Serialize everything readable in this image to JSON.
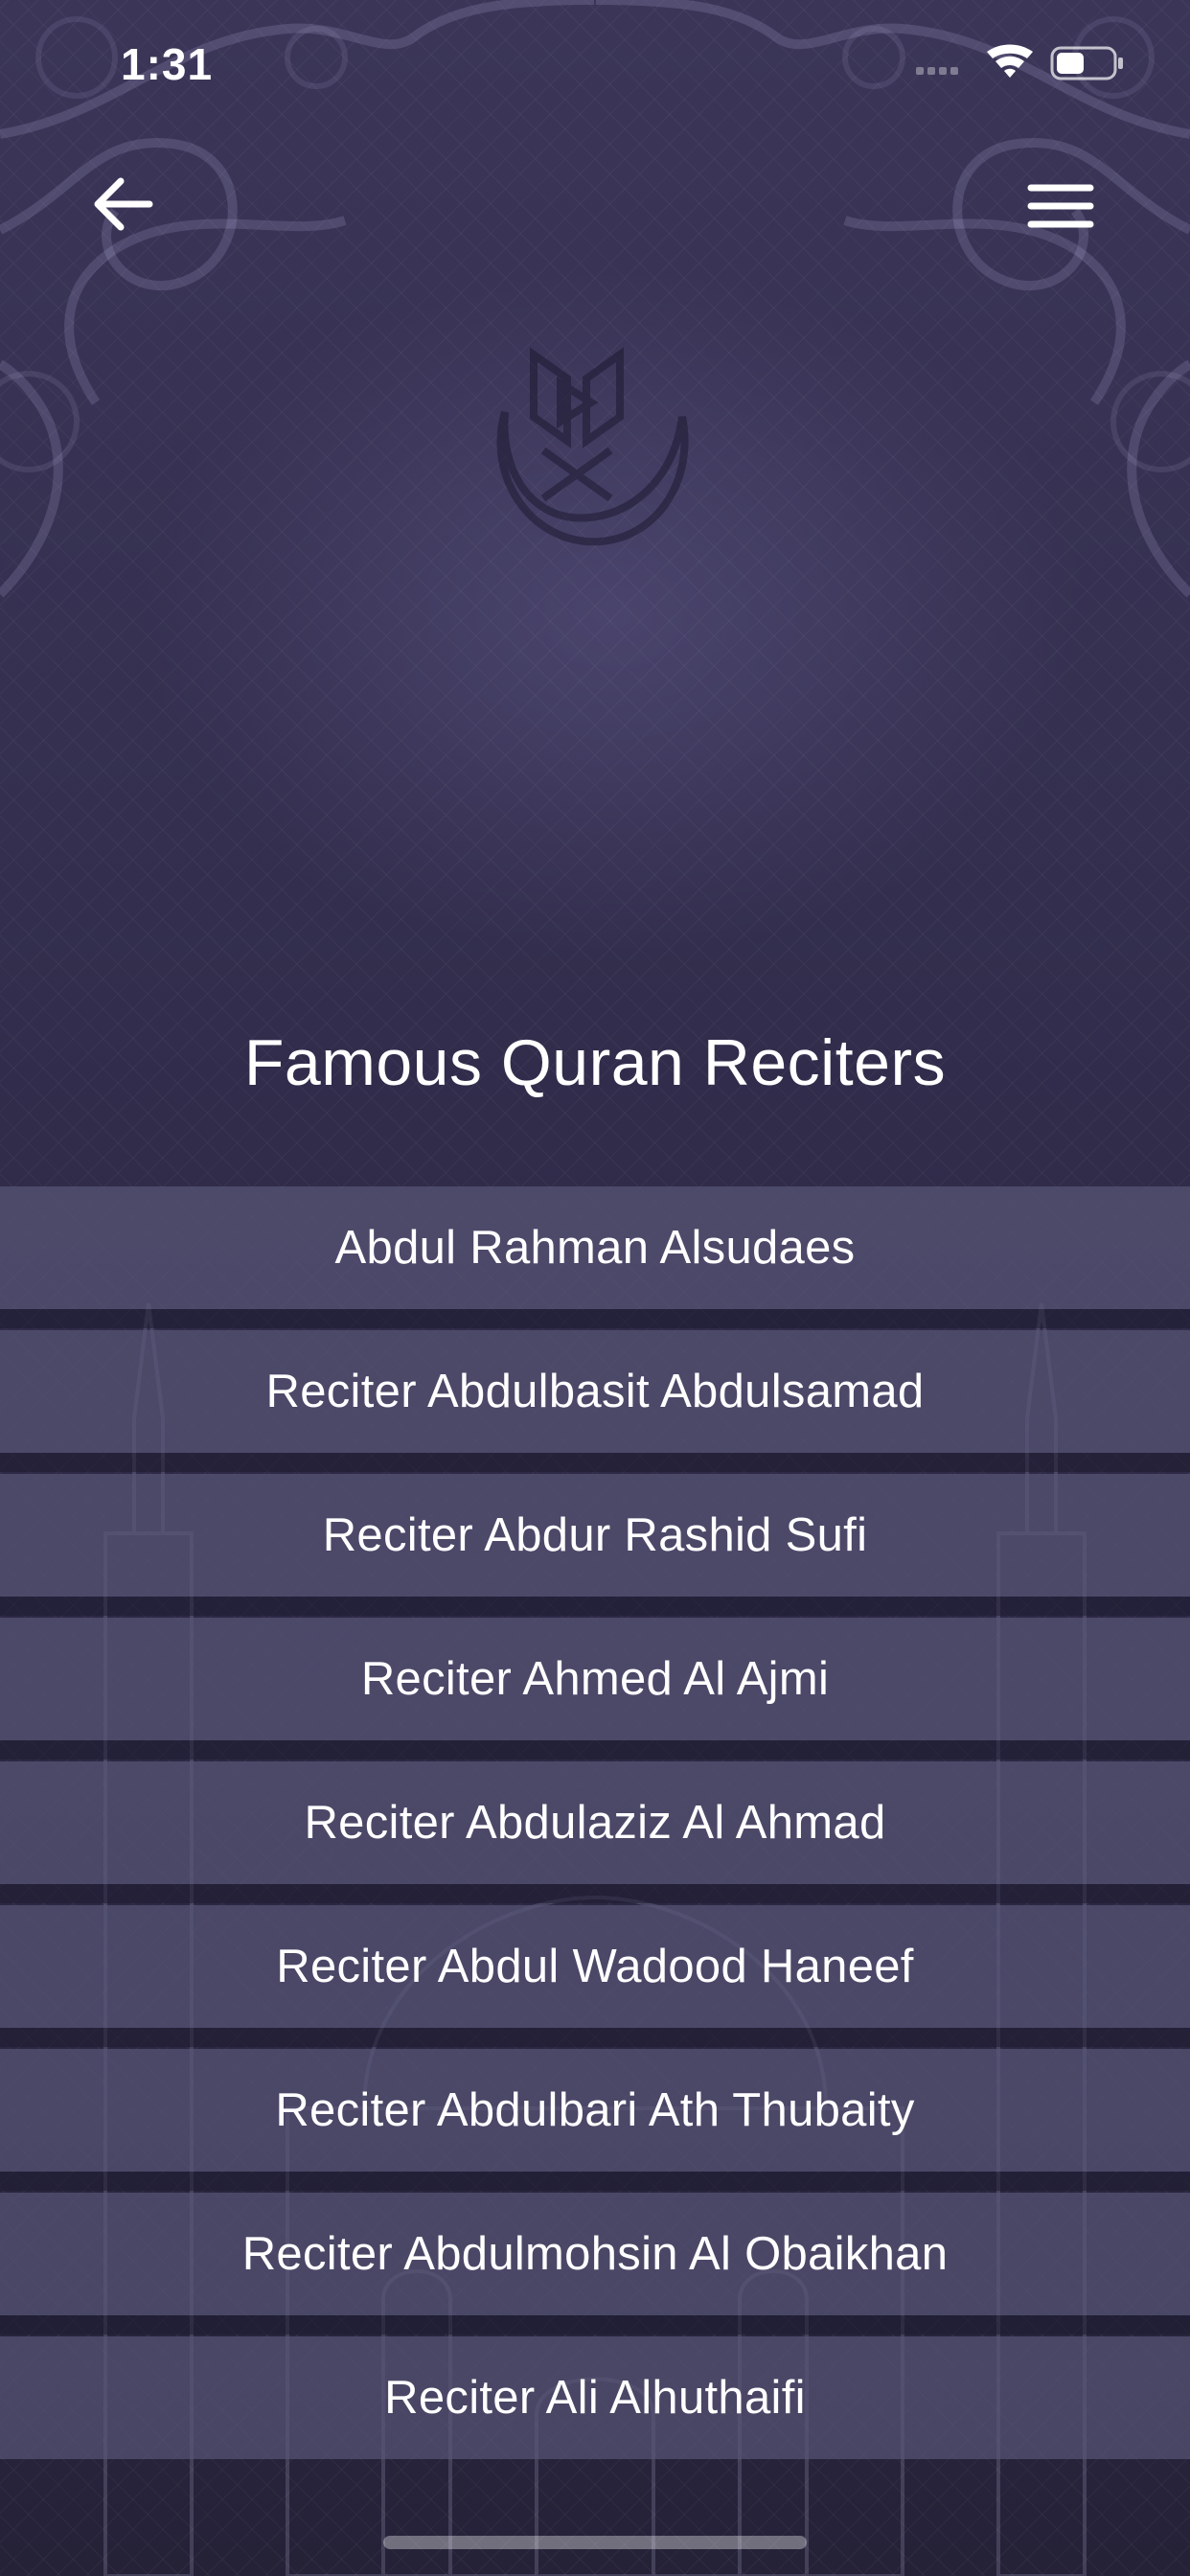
{
  "status_bar": {
    "time": "1:31",
    "icons": [
      "signal-icon",
      "wifi-icon",
      "battery-icon"
    ]
  },
  "nav": {
    "back_icon": "arrow-left-icon",
    "menu_icon": "hamburger-menu-icon"
  },
  "logo": {
    "icon": "quran-play-logo-icon"
  },
  "page": {
    "title": "Famous Quran Reciters"
  },
  "reciters": [
    {
      "label": "Abdul Rahman Alsudaes"
    },
    {
      "label": "Reciter Abdulbasit Abdulsamad"
    },
    {
      "label": "Reciter Abdur Rashid Sufi"
    },
    {
      "label": "Reciter Ahmed Al Ajmi"
    },
    {
      "label": "Reciter Abdulaziz Al Ahmad"
    },
    {
      "label": "Reciter Abdul Wadood Haneef"
    },
    {
      "label": "Reciter Abdulbari Ath Thubaity"
    },
    {
      "label": "Reciter Abdulmohsin Al Obaikhan"
    },
    {
      "label": "Reciter Ali Alhuthaifi"
    }
  ],
  "colors": {
    "background": "#2e2a47",
    "list_item": "#58547a",
    "text": "#ffffff"
  }
}
